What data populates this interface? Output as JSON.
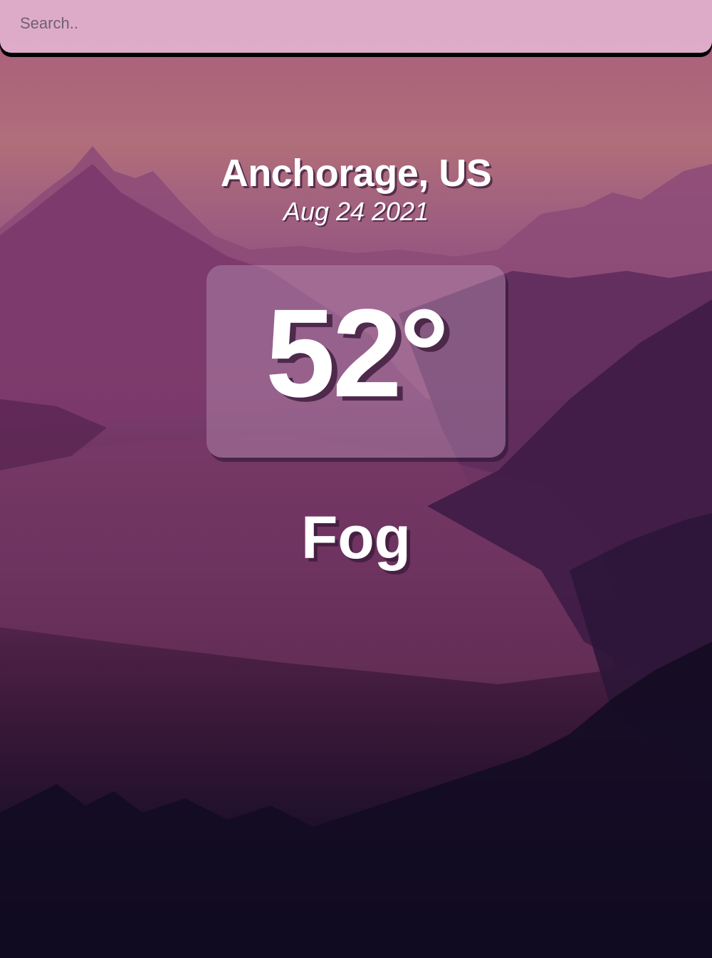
{
  "search": {
    "placeholder": "Search..",
    "value": ""
  },
  "weather": {
    "location": "Anchorage, US",
    "date": "Aug 24 2021",
    "temperature": "52°",
    "condition": "Fog"
  },
  "theme": {
    "search_bg": "#e2b2ce",
    "text_color": "#ffffff",
    "sky_top": "#a85a7c",
    "ground_bottom": "#0d0a1c"
  }
}
